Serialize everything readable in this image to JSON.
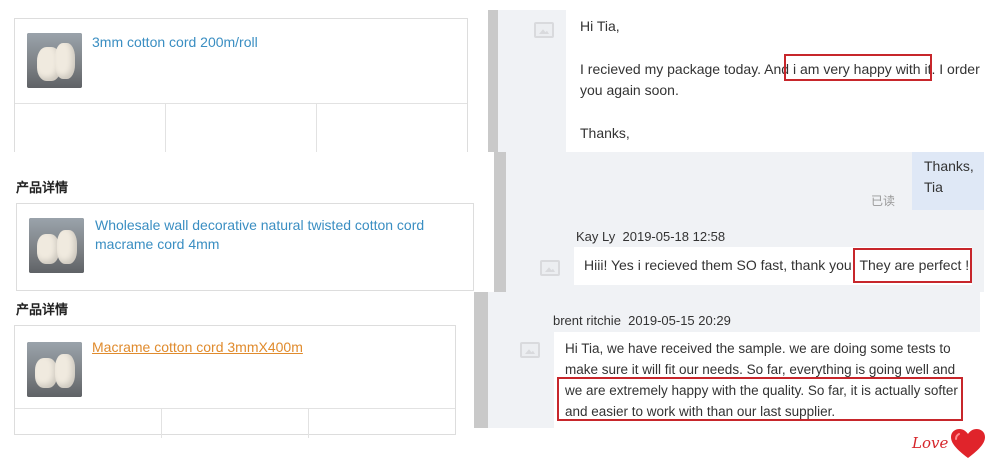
{
  "products": [
    {
      "title": "3mm cotton cord 200m/roll",
      "section": ""
    },
    {
      "title": "Wholesale wall decorative natural twisted cotton cord macrame cord 4mm",
      "section": "产品详情"
    },
    {
      "title": "Macrame cotton cord 3mmX400m",
      "section": "产品详情"
    }
  ],
  "messages": {
    "tia": {
      "greeting": "Hi Tia,",
      "body_line1_a": "I recieved my package today. And ",
      "body_line1_hl": "i am very happy with it.",
      "body_line1_b": " I order",
      "body_line2": "you again soon.",
      "closing": "Thanks,"
    },
    "sent": {
      "line1": "Thanks,",
      "line2": "Tia",
      "status": "已读"
    },
    "kay": {
      "name": "Kay Ly",
      "time": "2019-05-18 12:58",
      "text_a": "Hiii! Yes i recieved them SO fast, thank you.",
      "text_hl": "They are perfect !"
    },
    "brent": {
      "name": "brent ritchie",
      "time": "2019-05-15 20:29",
      "line1": "Hi Tia, we have received the sample. we are doing some tests to",
      "line2": "make sure it will fit our needs. So far, everything is going well and",
      "line3": "we are extremely happy with the quality. So far, it is actually softer",
      "line4": "and easier to work with than our last supplier."
    }
  },
  "watermark": "Love",
  "colors": {
    "link": "#3a8ec2",
    "link_active": "#e08b2d",
    "highlight": "#c7262b",
    "chat_bg": "#f0f2f5",
    "sent_bg": "#dfe8f6"
  }
}
